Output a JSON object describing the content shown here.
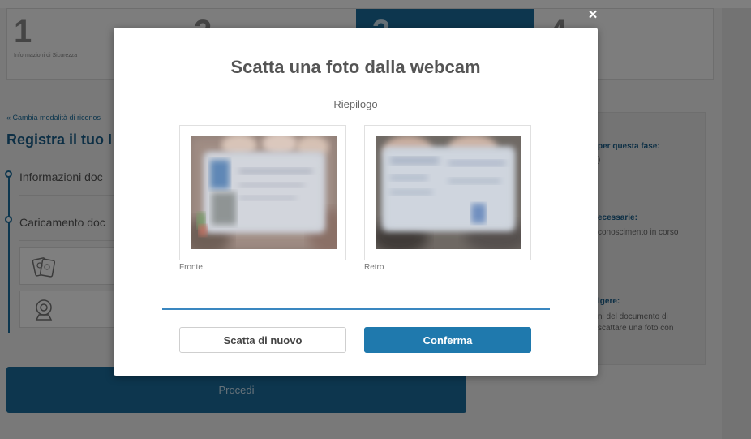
{
  "background": {
    "steps": [
      {
        "number": "1",
        "label": "Informazioni di Sicurezza"
      },
      {
        "number": "2",
        "label": ""
      },
      {
        "number": "3",
        "label": ""
      },
      {
        "number": "4",
        "label": ""
      }
    ],
    "back_link": "« Cambia modalità di riconos",
    "title": "Registra il tuo I",
    "rows": [
      "Informazioni doc",
      "Caricamento doc"
    ],
    "proceed_label": "Procedi",
    "side_panel": {
      "heading1": "per questa fase:",
      "text1": ")",
      "heading2": "ecessarie:",
      "text2": "conoscimento in corso",
      "heading3": "lgere:",
      "text3_line1": "ni del documento di",
      "text3_line2": "scattare una foto con"
    }
  },
  "modal": {
    "close_label": "×",
    "title": "Scatta una foto dalla webcam",
    "subtitle": "Riepilogo",
    "photos": [
      {
        "caption": "Fronte"
      },
      {
        "caption": "Retro"
      }
    ],
    "retake_label": "Scatta di nuovo",
    "confirm_label": "Conferma"
  },
  "colors": {
    "accent": "#1f79ad",
    "divider": "#3a87c0",
    "title_text": "#555555"
  }
}
